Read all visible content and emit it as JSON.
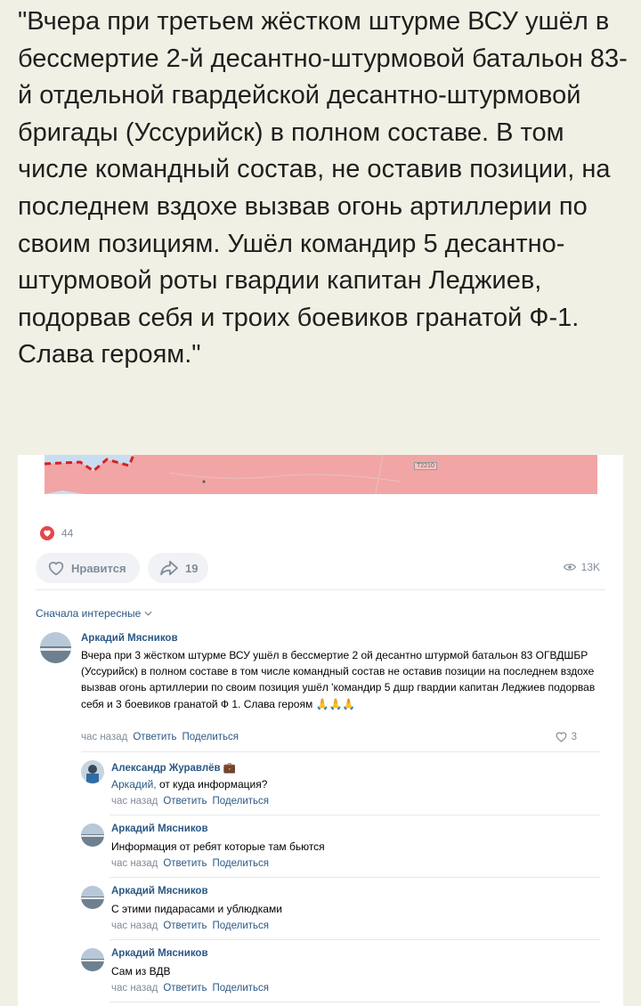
{
  "quote_text": "\"Вчера при третьем жёстком штурме ВСУ ушёл в бессмертие 2-й десантно-штурмовой батальон 83-й отдельной гвардейской десантно-штурмовой бригады (Уссурийск) в полном составе. В том числе командный состав, не оставив позиции, на последнем вздохе вызвав огонь артиллерии по своим позициям. Ушёл командир 5 десантно-штурмовой роты гвардии капитан Леджиев, подорвав себя и троих боевиков гранатой Ф-1. Слава героям.\"",
  "map": {
    "road_label": "T2210"
  },
  "post": {
    "reactions_count": "44",
    "like_label": "Нравится",
    "shares_count": "19",
    "views_count": "13K",
    "sort_label": "Сначала интересные"
  },
  "colors": {
    "accent": "#2a5885",
    "muted": "#818c99",
    "heart": "#e64646",
    "map_fill": "#f2a5a5"
  },
  "actions": {
    "reply": "Ответить",
    "share": "Поделиться"
  },
  "comments": [
    {
      "author": "Аркадий Мясников",
      "text": "Вчера при 3 жёстком штурме ВСУ ушёл в бессмертие 2 ой десантно штурмой батальон 83 ОГВДШБР (Уссурийск) в полном составе в том числе командный состав не оставив позиции на последнем вздохе вызвав огонь артиллерии по своим позиция ушёл 'командир 5 дшр гвардии капитан Леджиев подорвав себя и 3 боевиков гранатой Ф 1. Слава героям 🙏🙏🙏",
      "time": "час назад",
      "likes": "3"
    },
    {
      "author": "Александр Журавлёв 💼",
      "mention": "Аркадий,",
      "text": " от куда информация?",
      "time": "час назад"
    },
    {
      "author": "Аркадий Мясников",
      "text": "Информация от ребят которые там бьются",
      "time": "час назад"
    },
    {
      "author": "Аркадий Мясников",
      "text": "С этими пидарасами и ублюдками",
      "time": "час назад"
    },
    {
      "author": "Аркадий Мясников",
      "text": "Сам из ВДВ",
      "time": "час назад"
    }
  ]
}
